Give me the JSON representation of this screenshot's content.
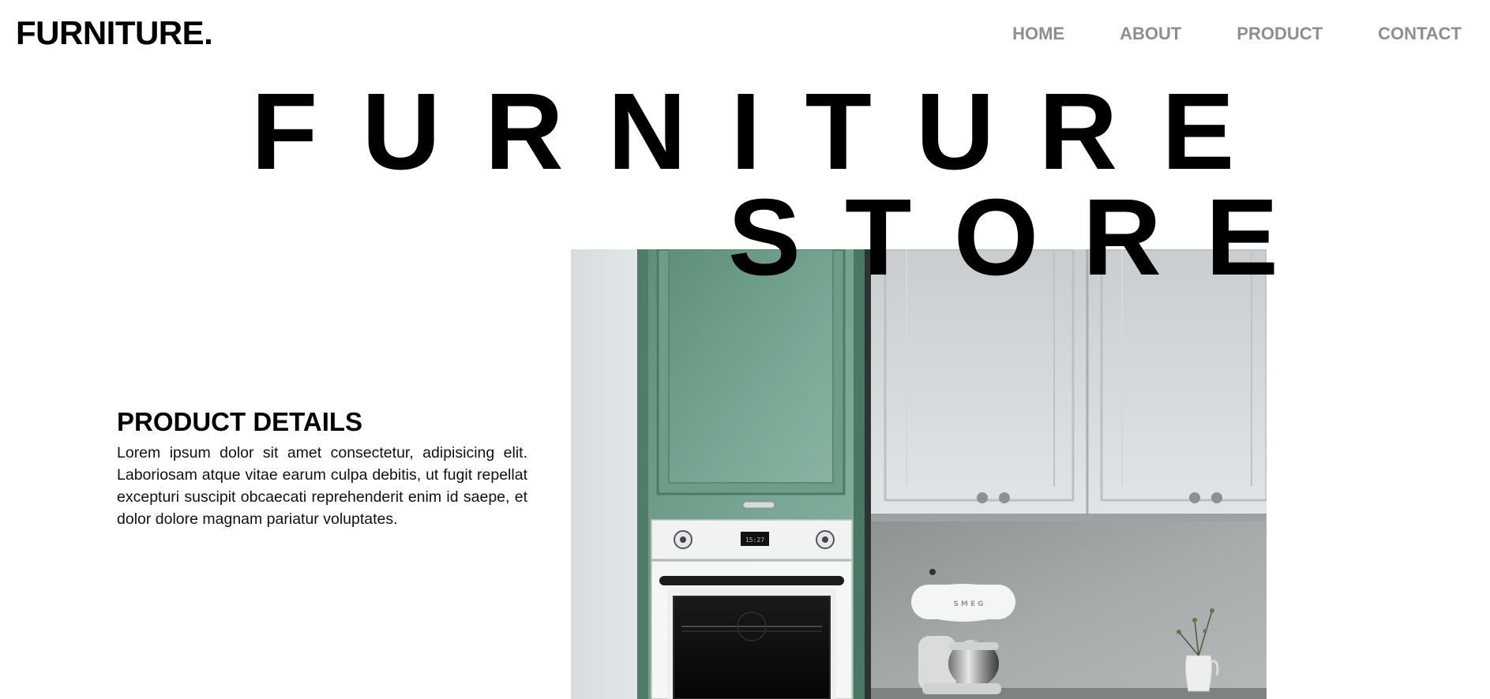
{
  "header": {
    "logo": "FURNITURE.",
    "nav": [
      {
        "label": "HOME"
      },
      {
        "label": "ABOUT"
      },
      {
        "label": "PRODUCT"
      },
      {
        "label": "CONTACT"
      }
    ]
  },
  "hero": {
    "title_line_1": "FURNITURE",
    "title_line_2": "STORE",
    "image_alt_icon": "kitchen-photo"
  },
  "details": {
    "heading": "PRODUCT DETAILS",
    "body": "Lorem ipsum dolor sit amet consectetur, adipisicing elit. Laboriosam atque vitae earum culpa debitis, ut fugit repellat excepturi suscipit obcaecati reprehenderit enim id saepe, et dolor dolore magnam pariatur voluptates.",
    "oven_display": "15:27",
    "mixer_brand": "SMEG"
  },
  "colors": {
    "nav_text": "#8e8e8e",
    "cabinet_green": "#6f9e8a",
    "cabinet_white": "#d4d8db",
    "wall_gray": "#a3a6a6"
  }
}
